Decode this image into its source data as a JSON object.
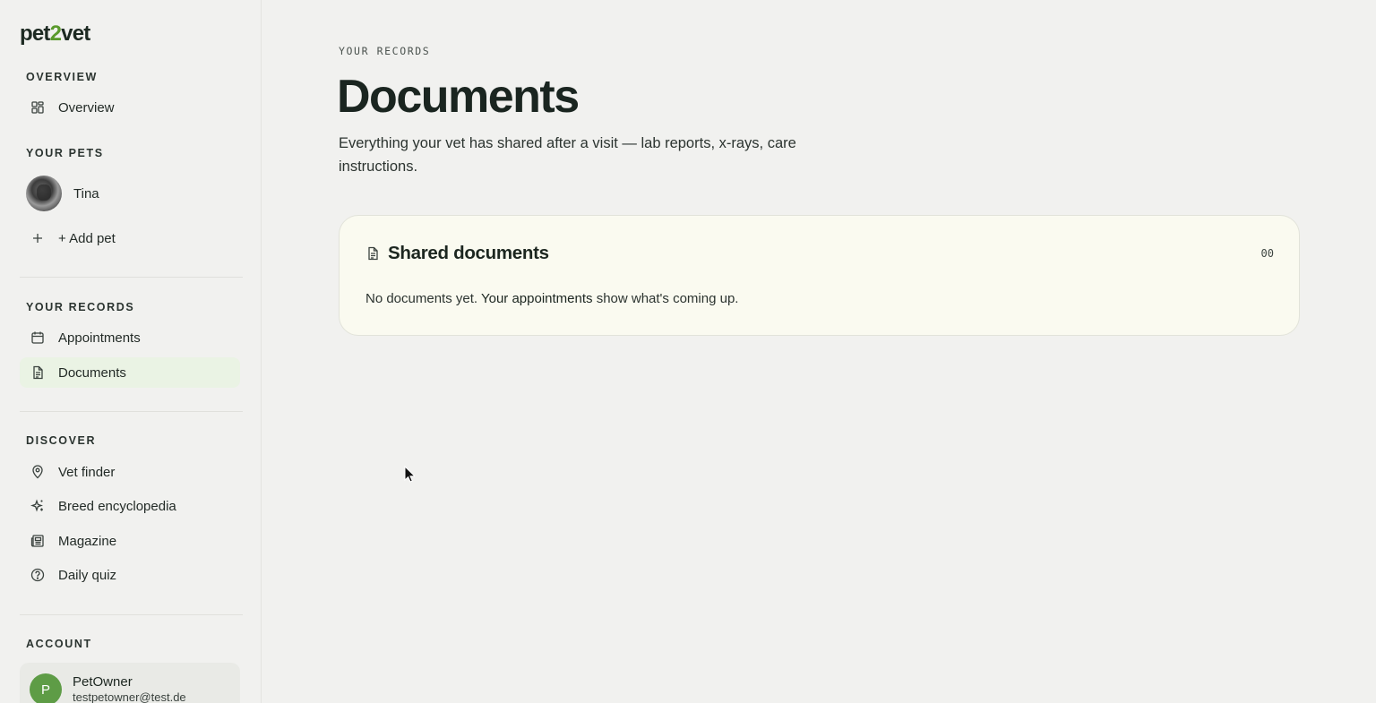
{
  "brand": {
    "pre": "pet",
    "mid": "2",
    "post": "vet"
  },
  "sidebar": {
    "overview_section": "OVERVIEW",
    "overview_item": "Overview",
    "pets_section": "YOUR PETS",
    "pet_name": "Tina",
    "add_pet": "+ Add pet",
    "records_section": "YOUR RECORDS",
    "appointments": "Appointments",
    "documents": "Documents",
    "discover_section": "DISCOVER",
    "vet_finder": "Vet finder",
    "breed_encyclopedia": "Breed encyclopedia",
    "magazine": "Magazine",
    "daily_quiz": "Daily quiz",
    "account_section": "ACCOUNT",
    "account_initial": "P",
    "account_name": "PetOwner",
    "account_email": "testpetowner@test.de"
  },
  "main": {
    "eyebrow": "YOUR RECORDS",
    "title": "Documents",
    "subtitle": "Everything your vet has shared after a visit — lab reports, x-rays, care instructions.",
    "card": {
      "title": "Shared documents",
      "count": "00",
      "empty_text": "No documents yet.",
      "link_text": "Your appointments",
      "after_link": "show what's coming up."
    }
  },
  "colors": {
    "accent": "#5a9a2c",
    "active_bg": "#eaf3e4",
    "avatar": "#5e9c46",
    "card_bg": "#fafaf0"
  },
  "icons": [
    "grid-icon",
    "plus-icon",
    "calendar-icon",
    "document-icon",
    "map-pin-icon",
    "sparkle-icon",
    "newspaper-icon",
    "help-circle-icon",
    "cursor-icon"
  ]
}
